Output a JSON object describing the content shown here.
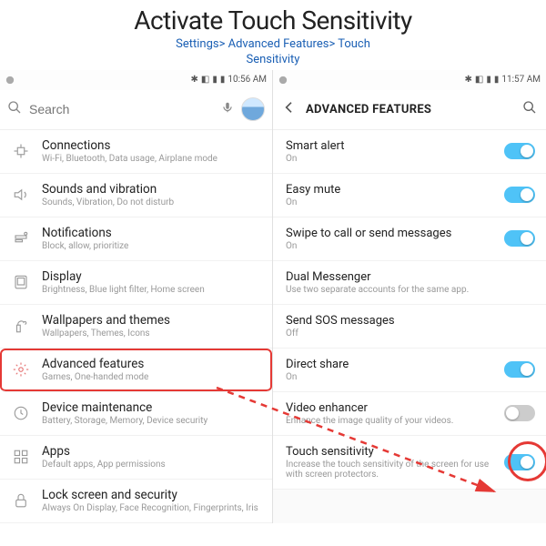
{
  "header": {
    "title": "Activate Touch Sensitivity",
    "breadcrumb_line1": "Settings> Advanced Features> Touch",
    "breadcrumb_line2": "Sensitivity"
  },
  "left_status": {
    "time": "10:56 AM"
  },
  "right_status": {
    "time": "11:57 AM"
  },
  "search": {
    "placeholder": "Search"
  },
  "settings": [
    {
      "icon": "connections-icon",
      "label": "Connections",
      "sub": "Wi-Fi, Bluetooth, Data usage, Airplane mode"
    },
    {
      "icon": "sound-icon",
      "label": "Sounds and vibration",
      "sub": "Sounds, Vibration, Do not disturb"
    },
    {
      "icon": "notifications-icon",
      "label": "Notifications",
      "sub": "Block, allow, prioritize"
    },
    {
      "icon": "display-icon",
      "label": "Display",
      "sub": "Brightness, Blue light filter, Home screen"
    },
    {
      "icon": "wallpaper-icon",
      "label": "Wallpapers and themes",
      "sub": "Wallpapers, Themes, Icons"
    },
    {
      "icon": "advanced-icon",
      "label": "Advanced features",
      "sub": "Games, One-handed mode",
      "highlight": true
    },
    {
      "icon": "maintenance-icon",
      "label": "Device maintenance",
      "sub": "Battery, Storage, Memory, Device security"
    },
    {
      "icon": "apps-icon",
      "label": "Apps",
      "sub": "Default apps, App permissions"
    },
    {
      "icon": "lock-icon",
      "label": "Lock screen and security",
      "sub": "Always On Display, Face Recognition, Fingerprints, Iris"
    }
  ],
  "af_header": {
    "title": "ADVANCED FEATURES"
  },
  "af_items": [
    {
      "label": "Smart alert",
      "sub": "On",
      "toggle": "on"
    },
    {
      "label": "Easy mute",
      "sub": "On",
      "toggle": "on"
    },
    {
      "label": "Swipe to call or send messages",
      "sub": "On",
      "toggle": "on"
    },
    {
      "label": "Dual Messenger",
      "sub": "Use two separate accounts for the same app.",
      "toggle": null
    },
    {
      "label": "Send SOS messages",
      "sub": "Off",
      "toggle": null
    },
    {
      "label": "Direct share",
      "sub": "On",
      "toggle": "on"
    },
    {
      "label": "Video enhancer",
      "sub": "Enhance the image quality of your videos.",
      "toggle": "off"
    },
    {
      "label": "Touch sensitivity",
      "sub": "Increase the touch sensitivity of the screen for use with screen protectors.",
      "toggle": "on",
      "circled": true
    }
  ]
}
